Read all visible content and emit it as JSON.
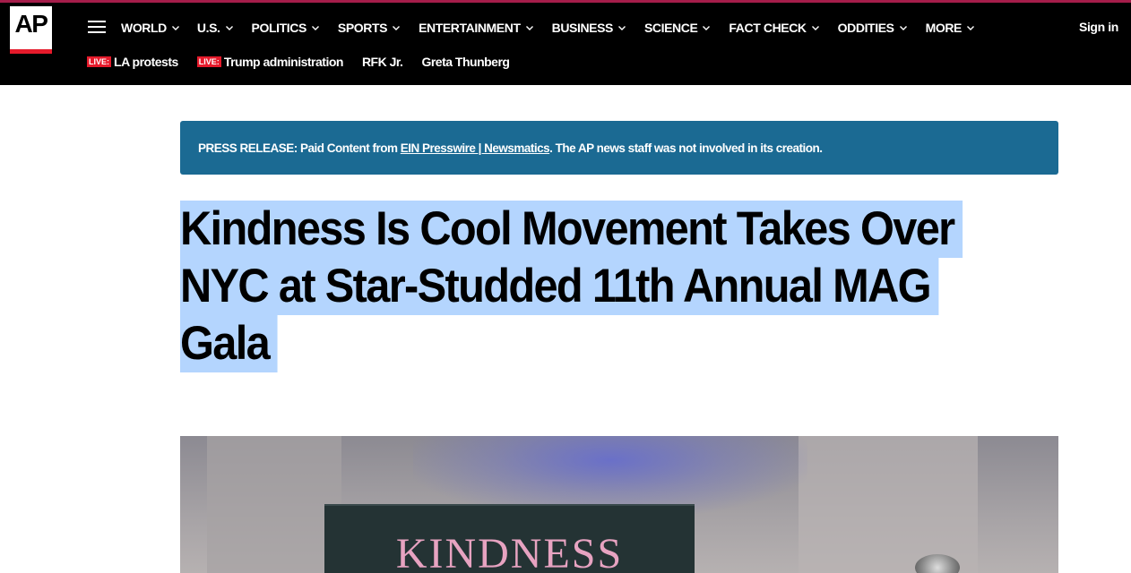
{
  "header": {
    "logo": "AP",
    "nav": [
      {
        "label": "WORLD"
      },
      {
        "label": "U.S."
      },
      {
        "label": "POLITICS"
      },
      {
        "label": "SPORTS"
      },
      {
        "label": "ENTERTAINMENT"
      },
      {
        "label": "BUSINESS"
      },
      {
        "label": "SCIENCE"
      },
      {
        "label": "FACT CHECK"
      },
      {
        "label": "ODDITIES"
      },
      {
        "label": "MORE"
      }
    ],
    "signin": "Sign in",
    "trending": [
      {
        "live": "LIVE:",
        "label": "LA protests"
      },
      {
        "live": "LIVE:",
        "label": "Trump administration"
      },
      {
        "live": "",
        "label": "RFK Jr."
      },
      {
        "live": "",
        "label": "Greta Thunberg"
      }
    ]
  },
  "press": {
    "prefix": "PRESS RELEASE: Paid Content from ",
    "link": "EIN Presswire | Newsmatics",
    "suffix": ". The AP news staff was not involved in its creation."
  },
  "article": {
    "headline_lines": [
      "Kindness Is Cool Movement Takes Over",
      "NYC at Star-Studded 11th Annual MAG",
      "Gala"
    ]
  },
  "hero": {
    "banner_text": "KINDNESS"
  },
  "colors": {
    "header_bg": "#000000",
    "accent_red": "#e51a2b",
    "press_bg": "#1b6a93",
    "selection": "#b4d5fe"
  }
}
